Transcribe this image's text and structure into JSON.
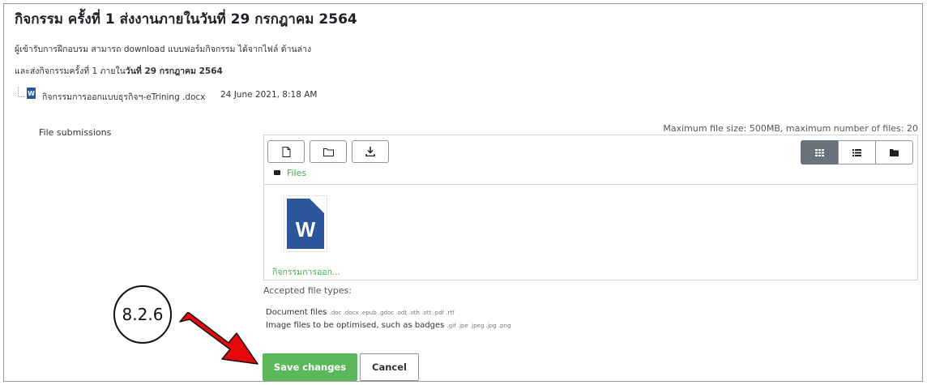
{
  "page": {
    "title": "กิจกรรม ครั้งที่ 1 ส่งงานภายในวันที่ 29 กรกฎาคม 2564",
    "description_line1": "ผู้เข้ารับการฝึกอบรม สามารถ download แบบฟอร์มกิจกรรม ได้จากไฟล์ ด้านล่าง",
    "description_line2_prefix": "และส่งกิจกรรมครั้งที่ 1 ภายใน",
    "description_line2_bold": "วันที่ 29 กรกฎาคม 2564",
    "attachment": {
      "filename": "กิจกรรมการออกแบบธุรกิจฯ-eTrining .docx",
      "date": "24 June 2021, 8:18 AM",
      "icon": "word-doc-icon"
    }
  },
  "form": {
    "field_label": "File submissions",
    "max_info": "Maximum file size: 500MB, maximum number of files: 20",
    "toolbar": {
      "add_file_icon": "file-icon",
      "create_folder_icon": "folder-icon",
      "download_icon": "download-icon",
      "views": [
        "grid-view-icon",
        "list-view-icon",
        "tree-view-icon"
      ],
      "active_view": "grid-view-icon"
    },
    "breadcrumb": "Files",
    "files": [
      {
        "name": "กิจกรรมการออก...",
        "icon": "word-doc-icon",
        "letter": "W"
      }
    ],
    "accepted_label": "Accepted file types:",
    "types": [
      {
        "label": "Document files",
        "ext": ".doc .docx .epub .gdoc .odt .oth .ott .pdf .rtf"
      },
      {
        "label": "Image files to be optimised, such as badges",
        "ext": ".gif .jpe .jpeg .jpg .png"
      }
    ],
    "save_label": "Save changes",
    "cancel_label": "Cancel"
  },
  "annotation": {
    "step_label": "8.2.6",
    "arrow_color": "#e5090c"
  },
  "colors": {
    "save_button": "#5cb85c",
    "link_green": "#3dae4d",
    "word_blue": "#2b579a"
  }
}
